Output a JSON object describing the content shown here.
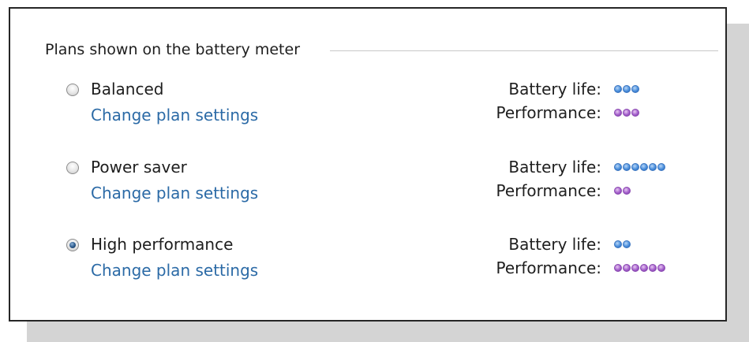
{
  "group_title": "Plans shown on the battery meter",
  "labels": {
    "battery_life": "Battery life:",
    "performance": "Performance:"
  },
  "colors": {
    "battery_dots": "#4a8fdc",
    "performance_dots": "#a35fcb",
    "link": "#2b6aa6"
  },
  "plans": [
    {
      "name": "Balanced",
      "link": "Change plan settings",
      "selected": false,
      "battery_life": 3,
      "performance": 3
    },
    {
      "name": "Power saver",
      "link": "Change plan settings",
      "selected": false,
      "battery_life": 6,
      "performance": 2
    },
    {
      "name": "High performance",
      "link": "Change plan settings",
      "selected": true,
      "battery_life": 2,
      "performance": 6
    }
  ]
}
